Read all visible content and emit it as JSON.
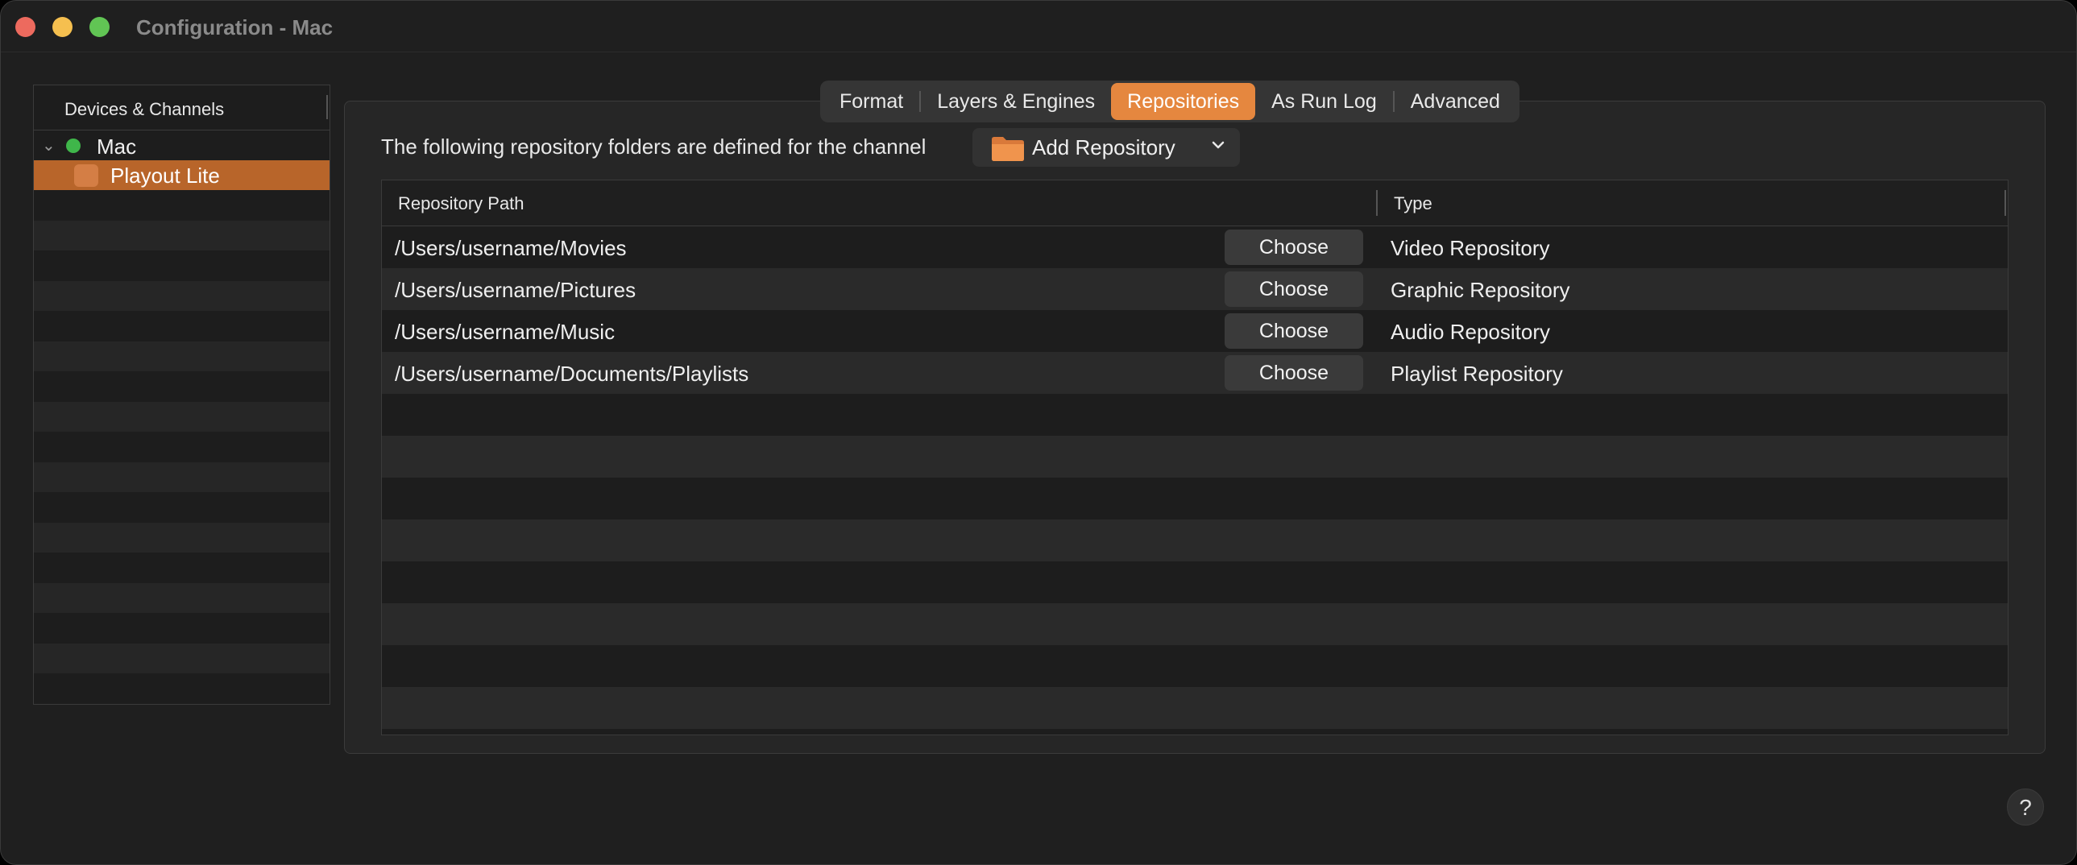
{
  "window": {
    "title": "Configuration - Mac"
  },
  "sidebar": {
    "header": "Devices & Channels",
    "device": {
      "label": "Mac",
      "status_color": "#3fb64a"
    },
    "channels": [
      {
        "label": "Playout Lite",
        "selected": true
      }
    ]
  },
  "tabs": [
    {
      "label": "Format",
      "active": false
    },
    {
      "label": "Layers & Engines",
      "active": false
    },
    {
      "label": "Repositories",
      "active": true
    },
    {
      "label": "As Run Log",
      "active": false
    },
    {
      "label": "Advanced",
      "active": false
    }
  ],
  "repositories": {
    "description": "The following repository folders are defined for the channel",
    "add_button_label": "Add Repository",
    "columns": {
      "path": "Repository Path",
      "type": "Type"
    },
    "choose_label": "Choose",
    "rows": [
      {
        "path": "/Users/username/Movies",
        "type": "Video Repository"
      },
      {
        "path": "/Users/username/Pictures",
        "type": "Graphic Repository"
      },
      {
        "path": "/Users/username/Music",
        "type": "Audio Repository"
      },
      {
        "path": "/Users/username/Documents/Playlists",
        "type": "Playlist Repository"
      }
    ]
  },
  "help": {
    "label": "?"
  },
  "colors": {
    "accent": "#e5873f",
    "selection": "#b8652a",
    "background": "#1f1f1f"
  }
}
